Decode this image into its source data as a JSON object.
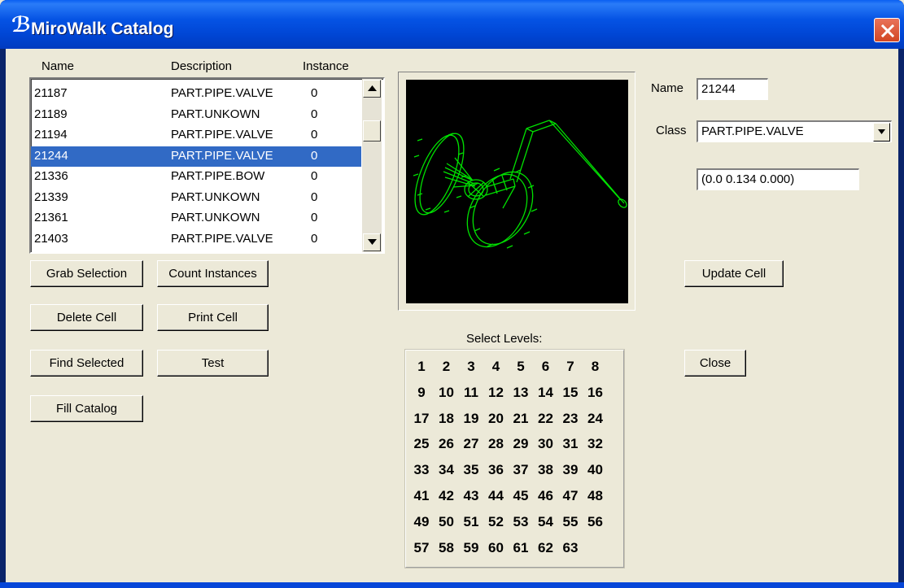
{
  "window": {
    "title": "MiroWalk Catalog"
  },
  "list": {
    "headers": {
      "name": "Name",
      "description": "Description",
      "instances": "Instance"
    },
    "rows": [
      {
        "name": "21187",
        "description": "PART.PIPE.VALVE",
        "instances": "0"
      },
      {
        "name": "21189",
        "description": "PART.UNKOWN",
        "instances": "0"
      },
      {
        "name": "21194",
        "description": "PART.PIPE.VALVE",
        "instances": "0"
      },
      {
        "name": "21244",
        "description": "PART.PIPE.VALVE",
        "instances": "0",
        "selected": true
      },
      {
        "name": "21336",
        "description": "PART.PIPE.BOW",
        "instances": "0"
      },
      {
        "name": "21339",
        "description": "PART.UNKOWN",
        "instances": "0"
      },
      {
        "name": "21361",
        "description": "PART.UNKOWN",
        "instances": "0"
      },
      {
        "name": "21403",
        "description": "PART.PIPE.VALVE",
        "instances": "0"
      }
    ]
  },
  "buttons": {
    "grab_selection": "Grab Selection",
    "count_instances": "Count Instances",
    "delete_cell": "Delete Cell",
    "print_cell": "Print Cell",
    "find_selected": "Find Selected",
    "test": "Test",
    "fill_catalog": "Fill Catalog",
    "update_cell": "Update Cell",
    "close": "Close"
  },
  "properties": {
    "name_label": "Name",
    "name_value": "21244",
    "class_label": "Class",
    "class_value": "PART.PIPE.VALVE",
    "coords_value": "(0.0 0.134 0.000)"
  },
  "levels": {
    "caption": "Select Levels:",
    "items": [
      "1",
      "2",
      "3",
      "4",
      "5",
      "6",
      "7",
      "8",
      "9",
      "10",
      "11",
      "12",
      "13",
      "14",
      "15",
      "16",
      "17",
      "18",
      "19",
      "20",
      "21",
      "22",
      "23",
      "24",
      "25",
      "26",
      "27",
      "28",
      "29",
      "30",
      "31",
      "32",
      "33",
      "34",
      "35",
      "36",
      "37",
      "38",
      "39",
      "40",
      "41",
      "42",
      "43",
      "44",
      "45",
      "46",
      "47",
      "48",
      "49",
      "50",
      "51",
      "52",
      "53",
      "54",
      "55",
      "56",
      "57",
      "58",
      "59",
      "60",
      "61",
      "62",
      "63"
    ]
  },
  "colors": {
    "titlebar": "#0054e3",
    "selection": "#316ac5",
    "preview_bg": "#000000",
    "wireframe": "#00e000",
    "dialog_bg": "#ece9d8"
  },
  "icons": {
    "app": "app-logo-icon",
    "close": "close-icon",
    "scroll_up": "arrow-up-icon",
    "scroll_down": "arrow-down-icon",
    "dropdown": "chevron-down-icon"
  }
}
